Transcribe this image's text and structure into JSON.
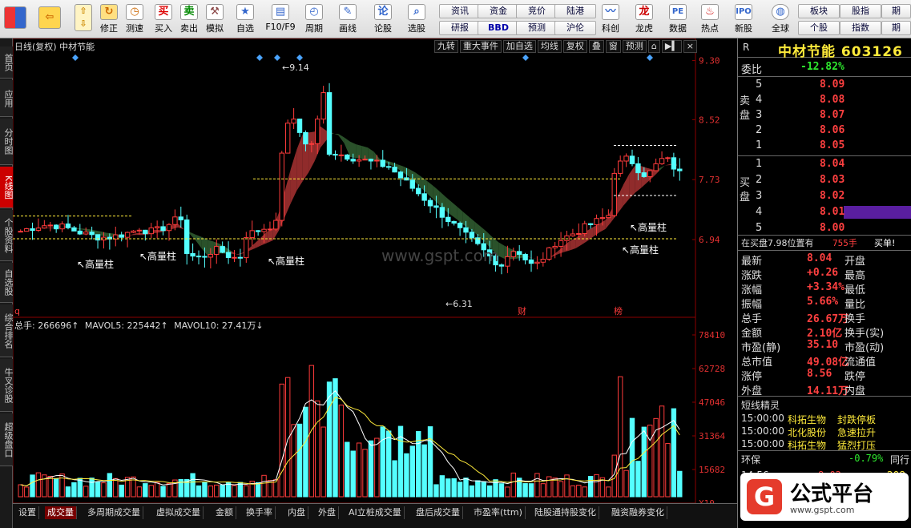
{
  "toolbar": {
    "buttons": [
      "买入",
      "卖出",
      "模拟",
      "自选",
      "F10/F9",
      "周期",
      "画线",
      "论股",
      "选股",
      "科创",
      "龙虎",
      "数据",
      "热点",
      "新股",
      "全球"
    ],
    "left_buttons": [
      "修正",
      "测速"
    ],
    "small_top": [
      "资讯",
      "资金",
      "竞价",
      "陆港",
      "板块",
      "股指",
      "期"
    ],
    "small_bottom": [
      "研报",
      "BBD",
      "预测",
      "沪伦",
      "个股",
      "指数",
      "期"
    ]
  },
  "left_tabs": [
    "首页",
    "应用",
    "分时图",
    "K线图",
    "个股资料",
    "自选股",
    "综合排名",
    "牛叉诊股",
    "超级盘口"
  ],
  "chart": {
    "title": "日线(复权)  中材节能",
    "tools": [
      "九转",
      "重大事件",
      "加自选",
      "均线",
      "复权",
      "叠",
      "窗",
      "预测"
    ],
    "price_axis": [
      "9.30",
      "8.52",
      "7.73",
      "6.94"
    ],
    "vol_axis": [
      "78410",
      "62728",
      "47046",
      "31364",
      "15682",
      "X10"
    ],
    "high_label": "9.14",
    "low_label": "6.31",
    "annot": [
      "高量柱",
      "高量柱",
      "高量柱",
      "高量柱",
      "高量柱"
    ],
    "markers": [
      "财",
      "榜"
    ],
    "q_label": "q",
    "vol_legend": {
      "zs": "总手: 266696↑",
      "m5": "MAVOL5: 225442↑",
      "m10": "MAVOL10: 27.41万↓"
    },
    "watermark": "www.gspt.com"
  },
  "bottom_tabs": [
    "设置",
    "成交量",
    "多周期成交量",
    "虚拟成交量",
    "金额",
    "换手率",
    "内盘",
    "外盘",
    "AI立桩成交量",
    "盘后成交量",
    "市盈率(ttm)",
    "陆股通持股变化",
    "融资融券变化"
  ],
  "right": {
    "r": "R",
    "name": "中材节能 603126",
    "weibi_lbl": "委比",
    "weibi_val": "-12.82%",
    "sell_word": "卖盘",
    "buy_word": "买盘",
    "asks": [
      {
        "lv": "5",
        "p": "8.09"
      },
      {
        "lv": "4",
        "p": "8.08"
      },
      {
        "lv": "3",
        "p": "8.07"
      },
      {
        "lv": "2",
        "p": "8.06"
      },
      {
        "lv": "1",
        "p": "8.05"
      }
    ],
    "bids": [
      {
        "lv": "1",
        "p": "8.04"
      },
      {
        "lv": "2",
        "p": "8.03"
      },
      {
        "lv": "3",
        "p": "8.02"
      },
      {
        "lv": "4",
        "p": "8.01"
      },
      {
        "lv": "5",
        "p": "8.00"
      }
    ],
    "buy_info": "在买盘7.98位置有",
    "buy_qty": "755手",
    "buy_tag": "买单!",
    "quotes": [
      {
        "l": "最新",
        "v": "8.04",
        "l2": "开盘"
      },
      {
        "l": "涨跌",
        "v": "+0.26",
        "l2": "最高"
      },
      {
        "l": "涨幅",
        "v": "+3.34%",
        "l2": "最低"
      },
      {
        "l": "振幅",
        "v": "5.66%",
        "l2": "量比"
      },
      {
        "l": "总手",
        "v": "26.67万",
        "l2": "换手"
      },
      {
        "l": "金额",
        "v": "2.10亿",
        "l2": "换手(实)"
      },
      {
        "l": "市盈(静)",
        "v": "35.10",
        "l2": "市盈(动)"
      },
      {
        "l": "总市值",
        "v": "49.08亿",
        "l2": "流通值"
      },
      {
        "l": "涨停",
        "v": "8.56",
        "l2": "跌停"
      },
      {
        "l": "外盘",
        "v": "14.11万",
        "l2": "内盘"
      }
    ],
    "elf_title": "短线精灵",
    "elf": [
      {
        "t": "15:00:00",
        "s": "科拓生物",
        "e": "封跌停板"
      },
      {
        "t": "15:00:00",
        "s": "北化股份",
        "e": "急速拉升"
      },
      {
        "t": "15:00:00",
        "s": "科拓生物",
        "e": "猛烈打压"
      }
    ],
    "sector": "环保",
    "sector_val": "-0.79%",
    "sector_tag": "同行",
    "tick_time": "14:56",
    "tick_price": "8.02",
    "tick_vol": "208"
  },
  "wm": {
    "t1": "公式平台",
    "t2": "www.gspt.com",
    "logo": "G"
  }
}
